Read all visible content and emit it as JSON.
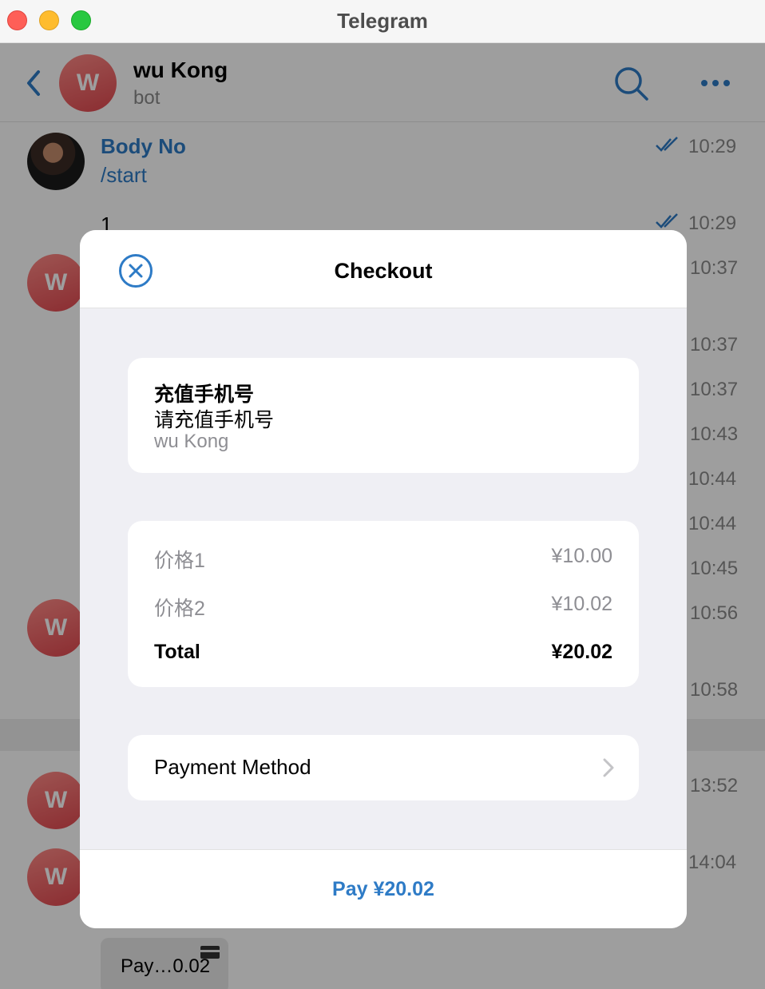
{
  "window": {
    "title": "Telegram"
  },
  "chat": {
    "name": "wu Kong",
    "status": "bot",
    "avatar_letter": "W",
    "messages": [
      {
        "sender": "Body No",
        "text": "/start",
        "time": "10:29"
      },
      {
        "text": "1",
        "time": "10:29"
      }
    ],
    "times": [
      "10:37",
      "10:37",
      "10:37",
      "10:43",
      "10:44",
      "10:44",
      "10:45",
      "10:56",
      "10:58",
      "13:52",
      "14:04"
    ],
    "pay_chip_label": "Pay…0.02"
  },
  "checkout": {
    "title": "Checkout",
    "product": {
      "title": "充值手机号",
      "description": "请充值手机号",
      "bot": "wu Kong"
    },
    "prices": [
      {
        "label": "价格1",
        "value": "¥10.00"
      },
      {
        "label": "价格2",
        "value": "¥10.02"
      }
    ],
    "total": {
      "label": "Total",
      "value": "¥20.02"
    },
    "payment_method_label": "Payment Method",
    "pay_button_label": "Pay ¥20.02"
  },
  "colors": {
    "accent": "#2e7bc6",
    "avatar_gradient_start": "#ff8a86",
    "avatar_gradient_end": "#e0484f"
  },
  "icons": [
    "back-arrow-icon",
    "search-icon",
    "more-dots-icon",
    "double-check-icon",
    "close-circle-icon",
    "chevron-right-icon",
    "card-icon"
  ]
}
